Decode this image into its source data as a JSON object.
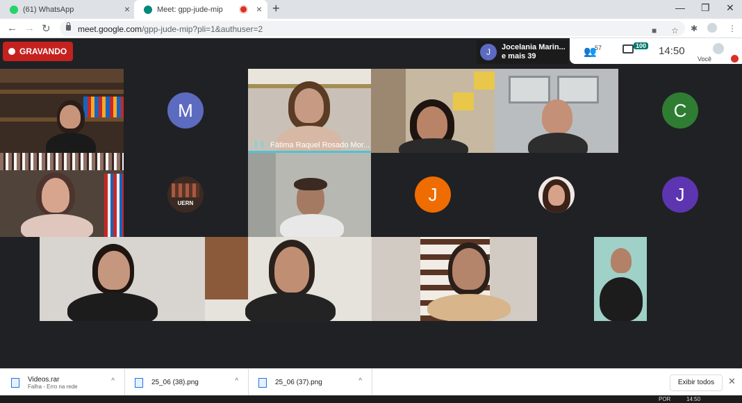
{
  "browser": {
    "tabs": [
      {
        "label": "(61) WhatsApp",
        "favicon_color": "#25d366"
      },
      {
        "label": "Meet: gpp-jude-mip",
        "favicon_color": "#00897b"
      }
    ],
    "url_host": "meet.google.com",
    "url_path": "/gpp-jude-mip?pli=1&authuser=2"
  },
  "meet": {
    "recording_label": "GRAVANDO",
    "presenter_initial": "J",
    "presenter_name": "Jocelania Marin...",
    "presenter_more": "e mais 39",
    "participants_count": "57",
    "chat_count": "100",
    "time": "14:50",
    "you_label": "Você",
    "tiles": [
      {
        "kind": "video",
        "desc": "woman-bookshelf"
      },
      {
        "kind": "avatar",
        "initial": "M",
        "color": "#5c6bc0"
      },
      {
        "kind": "video",
        "name": "Fátima Raquel Rosado Mor...",
        "speaking": true
      },
      {
        "kind": "video",
        "desc": "woman-glasses"
      },
      {
        "kind": "video",
        "desc": "man-glasses"
      },
      {
        "kind": "avatar",
        "initial": "C",
        "color": "#2e7d32"
      },
      {
        "kind": "video",
        "desc": "woman-smiling"
      },
      {
        "kind": "logo",
        "text": "UERN"
      },
      {
        "kind": "video",
        "desc": "woman-headset"
      },
      {
        "kind": "avatar",
        "initial": "J",
        "color": "#ef6c00"
      },
      {
        "kind": "photo",
        "desc": "woman-portrait"
      },
      {
        "kind": "avatar",
        "initial": "J",
        "color": "#5e35b1"
      },
      {
        "kind": "video",
        "desc": "woman-dark-hair"
      },
      {
        "kind": "video",
        "desc": "man-headset"
      },
      {
        "kind": "video",
        "desc": "man-window"
      },
      {
        "kind": "video",
        "desc": "man-standing"
      }
    ]
  },
  "downloads": [
    {
      "name": "Videos.rar",
      "status": "Falha - Erro na rede"
    },
    {
      "name": "25_06 (38).png",
      "status": ""
    },
    {
      "name": "25_06 (37).png",
      "status": ""
    }
  ],
  "show_all_label": "Exibir todos",
  "taskbar": {
    "lang": "POR",
    "time": "14:50"
  }
}
